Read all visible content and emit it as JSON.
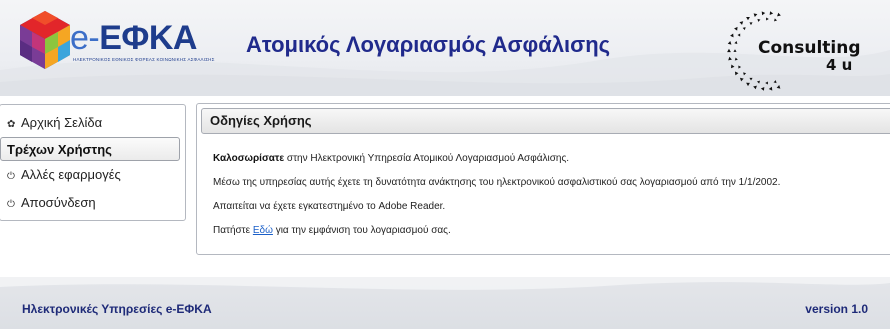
{
  "header": {
    "logo_prefix": "e-",
    "logo_main": "ΕΦΚΑ",
    "logo_subtitle": "ΗΛΕΚΤΡΟΝΙΚΟΣ ΕΘΝΙΚΟΣ ΦΟΡΕΑΣ ΚΟΙΝΩΝΙΚΗΣ ΑΣΦΑΛΙΣΗΣ",
    "app_title": "Ατομικός Λογαριασμός Ασφάλισης",
    "partner_logo_line1": "Consulting",
    "partner_logo_line2": "4 u",
    "logo_icon": "hexagon-cube-logo-icon",
    "partner_icon": "dotted-circle-logo-icon"
  },
  "sidebar": {
    "items": [
      {
        "label": "Αρχική Σελίδα",
        "icon": "gear-icon"
      },
      {
        "label": "Τρέχων Χρήστης",
        "icon": ""
      },
      {
        "label": "Αλλές εφαρμογές",
        "icon": "power-icon"
      },
      {
        "label": "Αποσύνδεση",
        "icon": "power-icon"
      }
    ]
  },
  "panel": {
    "title": "Οδηγίες Χρήσης",
    "welcome_bold": "Καλοσωρίσατε",
    "welcome_rest": " στην Ηλεκτρονική Υπηρεσία Ατομικού Λογαριασμού Ασφάλισης.",
    "line2": "Μέσω της υπηρεσίας αυτής έχετε τη δυνατότητα ανάκτησης του ηλεκτρονικού ασφαλιστικού σας λογαριασμού από την 1/1/2002.",
    "line3": "Απαιτείται να έχετε εγκατεστημένο το Adobe Reader.",
    "line4_pre": "Πατήστε ",
    "line4_link": "Εδώ",
    "line4_post": " για την εμφάνιση του λογαριασμού σας."
  },
  "footer": {
    "left": "Ηλεκτρονικές Υπηρεσίες e-ΕΦΚΑ",
    "right": "version 1.0"
  },
  "colors": {
    "brand_blue": "#1e3c8c",
    "title_blue": "#202a8c",
    "link_blue": "#1a5fc8"
  }
}
